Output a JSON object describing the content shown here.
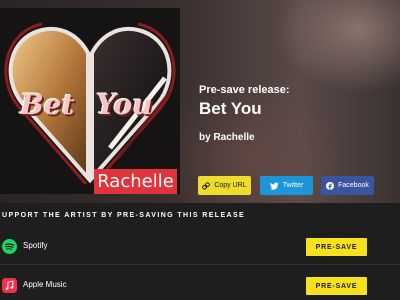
{
  "cover": {
    "title_word1": "Bet",
    "title_word2": "You",
    "artist": "Rachelle"
  },
  "release": {
    "label": "Pre-save release:",
    "title": "Bet You",
    "artist_line": "by Rachelle"
  },
  "share": {
    "copy_label": "Copy URL",
    "twitter_label": "Twitter",
    "facebook_label": "Facebook"
  },
  "support_heading": "UPPORT THE ARTIST BY PRE-SAVING THIS RELEASE",
  "services": [
    {
      "name": "Spotify",
      "icon": "spotify-icon",
      "button": "PRE-SAVE"
    },
    {
      "name": "Apple Music",
      "icon": "apple-music-icon",
      "button": "PRE-SAVE"
    }
  ],
  "colors": {
    "copy_button": "#f0dc2b",
    "twitter_button": "#1d95d9",
    "facebook_button": "#3a559f",
    "presave_button": "#f6e11c",
    "spotify": "#1ed760",
    "apple_music": "#fa2d48"
  }
}
